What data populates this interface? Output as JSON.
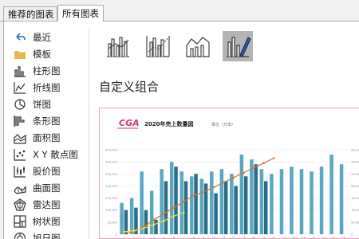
{
  "tabs": [
    {
      "label": "推荐的图表"
    },
    {
      "label": "所有图表"
    }
  ],
  "sidebar": {
    "items": [
      {
        "label": "最近",
        "icon": "undo-arrow-icon"
      },
      {
        "label": "模板",
        "icon": "folder-icon"
      },
      {
        "label": "柱形图",
        "icon": "column-chart-icon"
      },
      {
        "label": "折线图",
        "icon": "line-chart-icon"
      },
      {
        "label": "饼图",
        "icon": "pie-chart-icon"
      },
      {
        "label": "条形图",
        "icon": "bar-chart-icon"
      },
      {
        "label": "面积图",
        "icon": "area-chart-icon"
      },
      {
        "label": "X Y 散点图",
        "icon": "scatter-chart-icon"
      },
      {
        "label": "股价图",
        "icon": "stock-chart-icon"
      },
      {
        "label": "曲面图",
        "icon": "surface-chart-icon"
      },
      {
        "label": "雷达图",
        "icon": "radar-chart-icon"
      },
      {
        "label": "树状图",
        "icon": "treemap-chart-icon"
      },
      {
        "label": "旭日图",
        "icon": "sunburst-chart-icon"
      }
    ]
  },
  "combo_types": [
    {
      "icon": "clustered-column-line-icon"
    },
    {
      "icon": "clustered-column-line-secondary-axis-icon"
    },
    {
      "icon": "stacked-area-clustered-column-icon"
    },
    {
      "icon": "custom-combination-icon"
    }
  ],
  "combo_title": "自定义组合",
  "colors": {
    "accent_border": "#e0a8b8",
    "selected_bg": "#b4b4b4",
    "bar_teal": "#4a9bb8",
    "bar_dark": "#2b6c8a",
    "line_orange": "#e0742c",
    "line_yellow": "#e8e83a"
  },
  "chart_data": {
    "type": "bar",
    "logo": "CGA",
    "title": "2020年売上数量図",
    "subtitle": "単位（万本）",
    "categories": [
      "1",
      "2",
      "3",
      "4",
      "5",
      "6",
      "7",
      "8",
      "9",
      "10",
      "11",
      "12",
      "13",
      "14",
      "15",
      "16",
      "17",
      "18",
      "19",
      "20",
      "21",
      "22",
      "23"
    ],
    "series": [
      {
        "values": [
          130000,
          150000,
          260000,
          180000,
          270000,
          300000,
          260000,
          240000,
          230000,
          260000,
          270000,
          250000,
          330000,
          310000,
          270000,
          250000,
          270000,
          280000,
          270000,
          260000,
          280000,
          330000,
          290000
        ]
      },
      {
        "values": [
          100000,
          110000,
          100000,
          60000,
          220000,
          280000,
          220000,
          250000,
          210000,
          170000,
          220000,
          200000,
          240000,
          290000,
          220000,
          0,
          0,
          0,
          0,
          0,
          0,
          0,
          0
        ]
      },
      {
        "values": [
          10000,
          15000,
          25000,
          40000,
          55000,
          75000,
          90000
        ]
      },
      {
        "values": [
          8000,
          10000,
          30000,
          60000,
          85000,
          110000,
          135000,
          160000,
          175000,
          195000,
          215000,
          235000,
          255000,
          275000,
          295000,
          315000
        ]
      }
    ],
    "ylim": [
      0,
      350000
    ]
  }
}
